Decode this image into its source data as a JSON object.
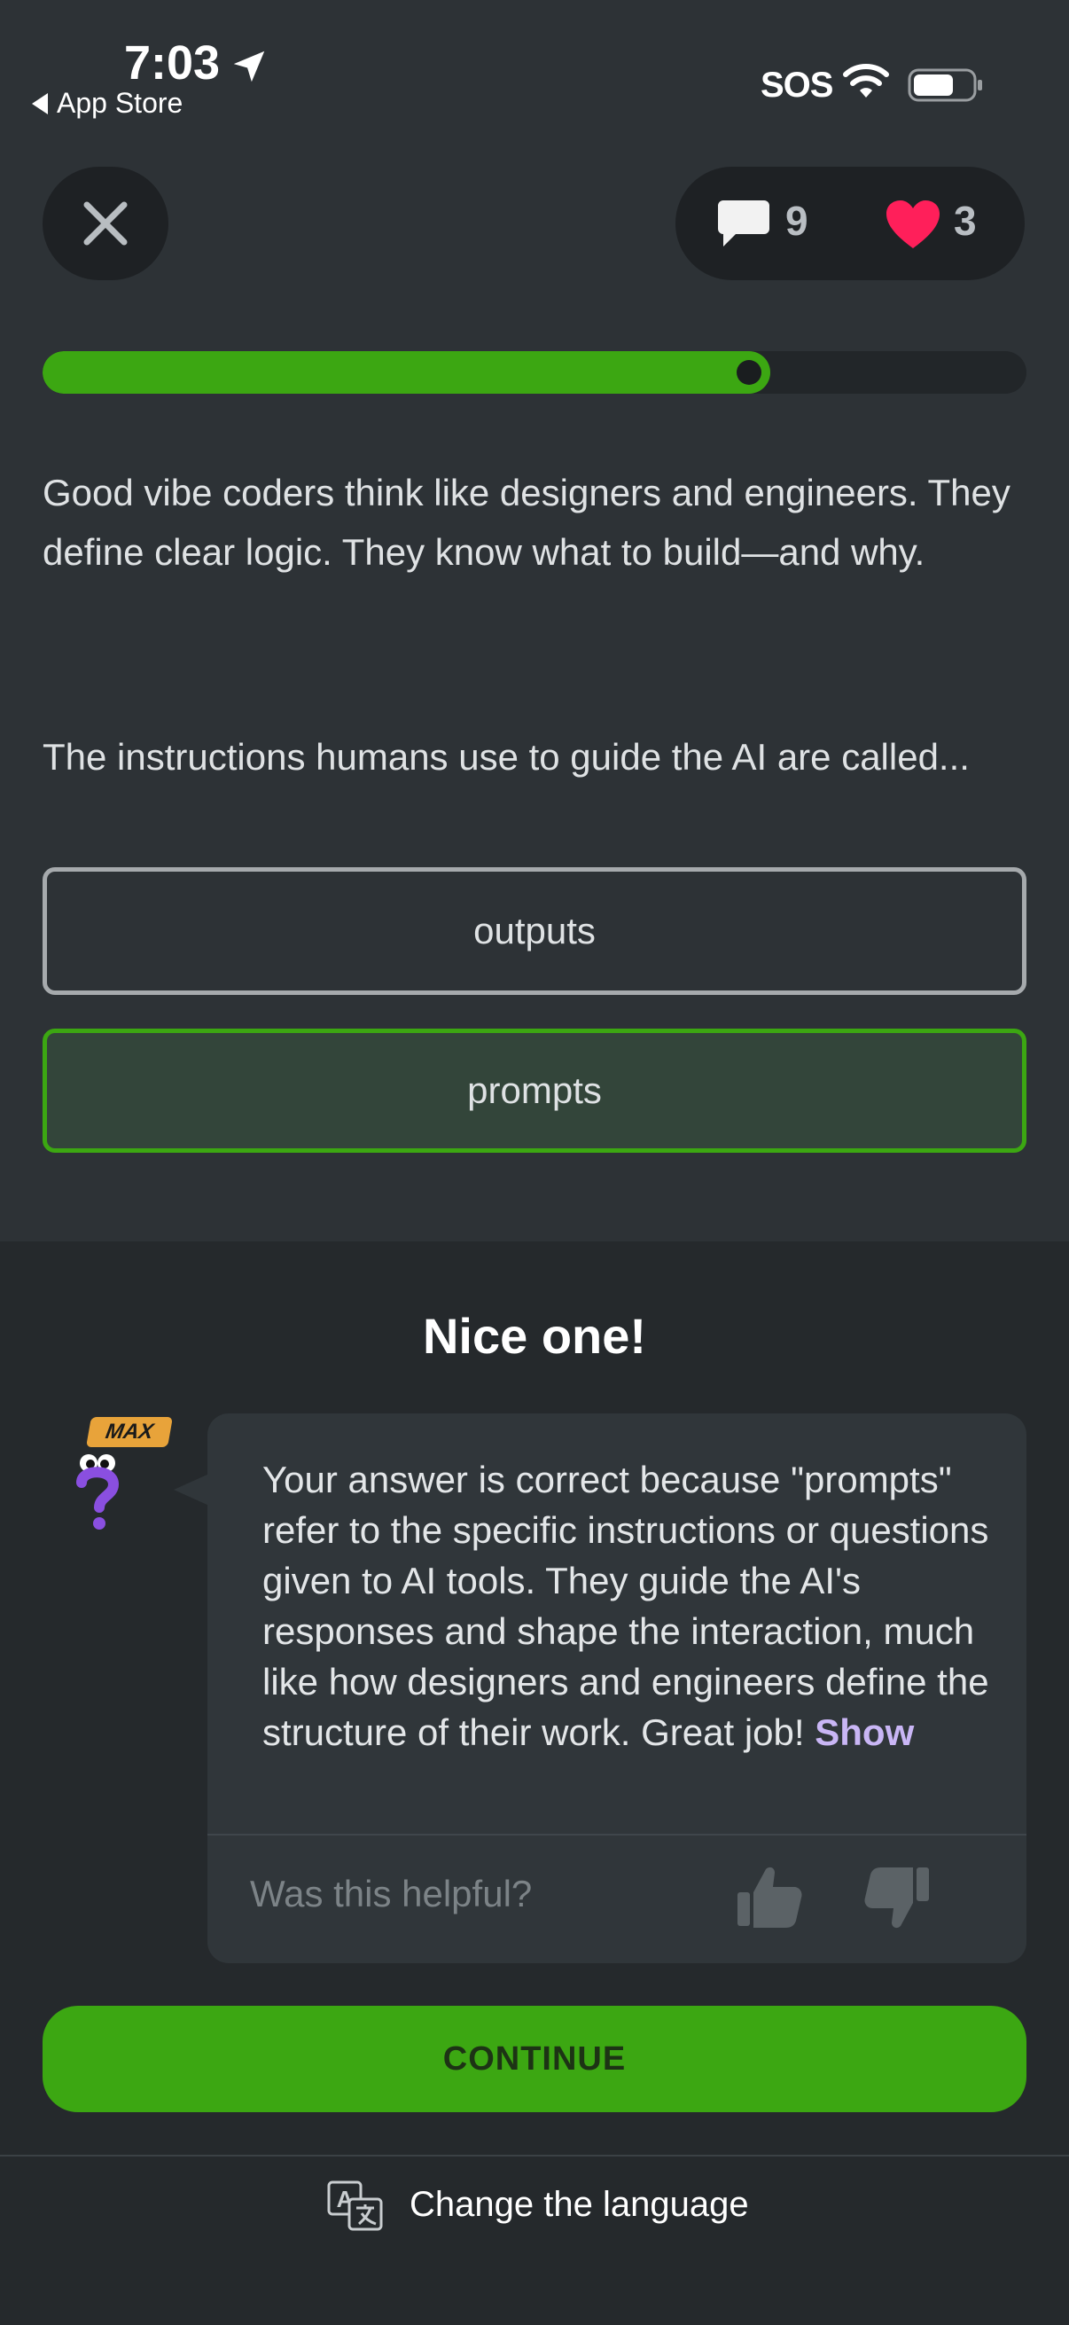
{
  "status_bar": {
    "time": "7:03",
    "back_app": "App Store",
    "sos": "SOS"
  },
  "header": {
    "comments_count": "9",
    "lives_count": "3",
    "progress_fraction": 0.74
  },
  "lesson": {
    "paragraph1": "Good vibe coders think like designers and engineers. They define clear logic. They know what to build—and why.",
    "paragraph2": "The instructions humans use to guide the AI are called...",
    "options": [
      {
        "label": "outputs",
        "state": "unselected"
      },
      {
        "label": "prompts",
        "state": "correct"
      }
    ]
  },
  "result": {
    "title": "Nice one!",
    "badge": "MAX",
    "explanation": "Your answer is correct because \"prompts\" refer to the specific instructions or questions given to AI tools. They guide the AI's responses and shape the interaction, much like how designers and engineers define the structure of their work. Great job!",
    "show_more": "Show",
    "helpful_prompt": "Was this helpful?"
  },
  "continue_label": "CONTINUE",
  "footer": {
    "language_label": "Change the language"
  },
  "colors": {
    "accent_green": "#3ca712",
    "heart_pink": "#ff1f5a",
    "mascot_purple": "#8a4fe0",
    "badge_orange": "#e8a33a",
    "link_purple": "#c9b6f5"
  },
  "icons": [
    "location-arrow-icon",
    "wifi-icon",
    "battery-icon",
    "close-icon",
    "chat-bubble-icon",
    "heart-icon",
    "mascot-icon",
    "thumbs-up-icon",
    "thumbs-down-icon",
    "translate-icon"
  ]
}
